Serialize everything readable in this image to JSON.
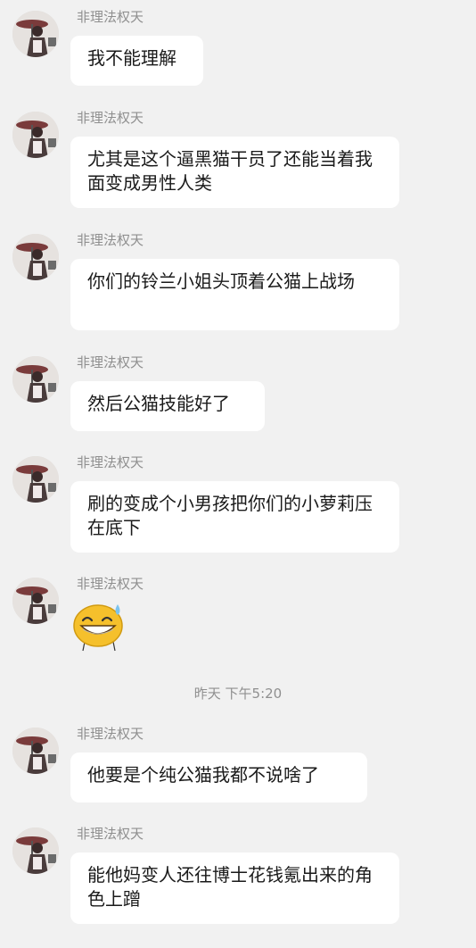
{
  "sender_name": "非理法权天",
  "messages": [
    {
      "text": "我不能理解"
    },
    {
      "text": "尤其是这个逼黑猫干员了还能当着我面变成男性人类"
    },
    {
      "text": "你们的铃兰小姐头顶着公猫上战场"
    },
    {
      "text": "然后公猫技能好了"
    },
    {
      "text": "刷的变成个小男孩把你们的小萝莉压在底下"
    },
    {
      "emoji": "grinning-sweat-emoji"
    },
    {
      "text": "他要是个纯公猫我都不说啥了"
    },
    {
      "text": "能他妈变人还往博士花钱氪出来的角色上蹭"
    }
  ],
  "timestamp": "昨天 下午5:20"
}
